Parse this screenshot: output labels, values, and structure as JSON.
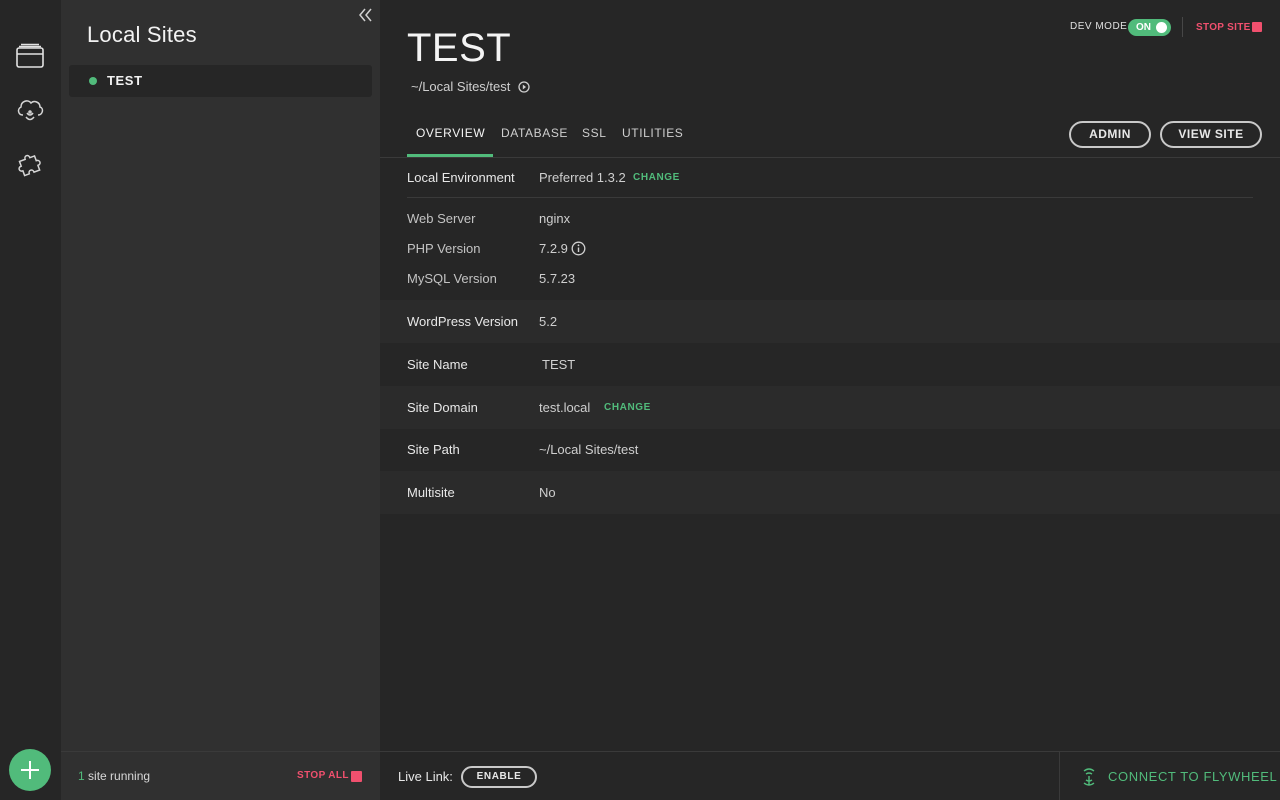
{
  "rail": {
    "icons": [
      "sites-icon",
      "cloud-icon",
      "addons-icon"
    ],
    "add_button_icon": "plus-icon"
  },
  "sidebar": {
    "title": "Local Sites",
    "sites": [
      {
        "name": "TEST",
        "status": "running"
      }
    ],
    "footer": {
      "running_count": "1",
      "running_text": " site running",
      "stop_all": "STOP ALL"
    }
  },
  "header": {
    "site_title": "TEST",
    "site_path": "~/Local Sites/test",
    "dev_mode_label": "DEV MODE",
    "dev_mode_toggle": "ON",
    "stop_site": "STOP SITE"
  },
  "tabs": [
    {
      "label": "OVERVIEW",
      "active": true
    },
    {
      "label": "DATABASE",
      "active": false
    },
    {
      "label": "SSL",
      "active": false
    },
    {
      "label": "UTILITIES",
      "active": false
    }
  ],
  "buttons": {
    "admin": "ADMIN",
    "view_site": "VIEW SITE"
  },
  "overview": {
    "local_environment": {
      "label": "Local Environment",
      "value": "Preferred 1.3.2",
      "action": "CHANGE"
    },
    "web_server": {
      "label": "Web Server",
      "value": "nginx"
    },
    "php_version": {
      "label": "PHP Version",
      "value": "7.2.9"
    },
    "mysql_version": {
      "label": "MySQL Version",
      "value": "5.7.23"
    },
    "wordpress_version": {
      "label": "WordPress Version",
      "value": "5.2"
    },
    "site_name": {
      "label": "Site Name",
      "value": "TEST"
    },
    "site_domain": {
      "label": "Site Domain",
      "value": "test.local",
      "action": "CHANGE"
    },
    "site_path": {
      "label": "Site Path",
      "value": "~/Local Sites/test"
    },
    "multisite": {
      "label": "Multisite",
      "value": "No"
    }
  },
  "footer": {
    "live_link_label": "Live Link:",
    "enable": "ENABLE",
    "connect": "CONNECT TO FLYWHEEL"
  },
  "colors": {
    "accent": "#51bb7b",
    "danger": "#f0506e",
    "background": "#262626",
    "sidebar": "#303030"
  }
}
